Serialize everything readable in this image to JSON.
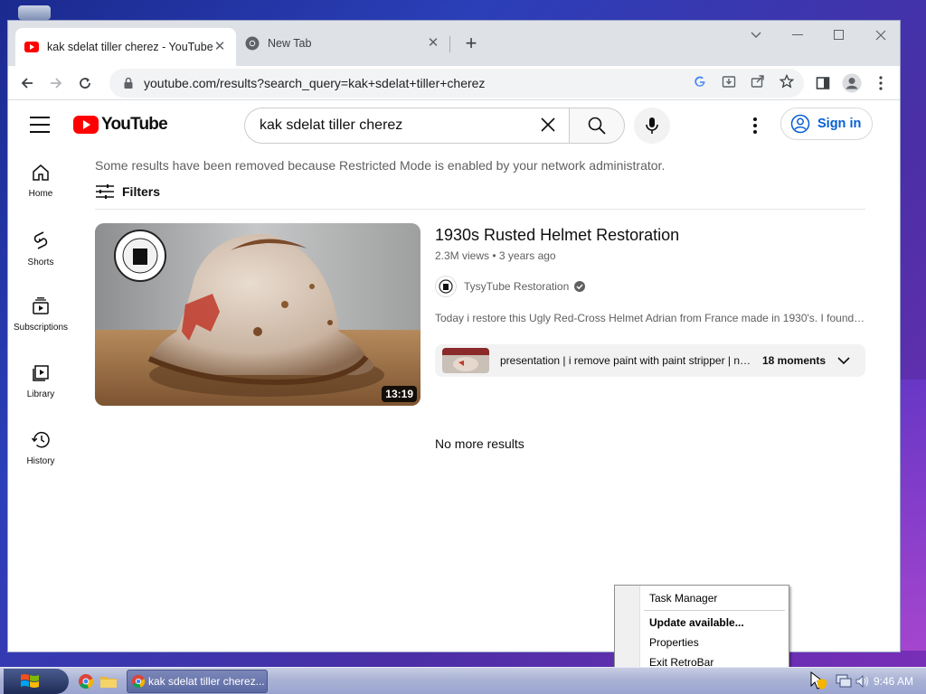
{
  "browser": {
    "active_tab_title": "kak sdelat tiller cherez - YouTube",
    "inactive_tab_title": "New Tab",
    "url": "youtube.com/results?search_query=kak+sdelat+tiller+cherez"
  },
  "youtube": {
    "logo_text": "YouTube",
    "search_value": "kak sdelat tiller cherez",
    "sign_in_label": "Sign in",
    "guide": [
      {
        "label": "Home",
        "icon": "home-icon"
      },
      {
        "label": "Shorts",
        "icon": "shorts-icon"
      },
      {
        "label": "Subscriptions",
        "icon": "subscriptions-icon"
      },
      {
        "label": "Library",
        "icon": "library-icon"
      },
      {
        "label": "History",
        "icon": "history-icon"
      }
    ],
    "notice": "Some results have been removed because Restricted Mode is enabled by your network administrator.",
    "filters_label": "Filters",
    "result": {
      "title": "1930s Rusted Helmet Restoration",
      "meta": "2.3M views • 3 years ago",
      "channel": "TysyTube Restoration",
      "description": "Today i restore this Ugly Red-Cross Helmet Adrian from France made in 1930's. I found this Helmet",
      "duration": "13:19",
      "chapter_text": "presentation | i remove paint with paint stripper | now i remove rust",
      "chapter_count": "18 moments"
    },
    "no_more": "No more results"
  },
  "context_menu": {
    "items": [
      "Task Manager",
      "Update available...",
      "Properties",
      "Exit RetroBar"
    ]
  },
  "taskbar": {
    "active_window": "kak sdelat tiller cherez...",
    "clock": "9:46 AM"
  }
}
